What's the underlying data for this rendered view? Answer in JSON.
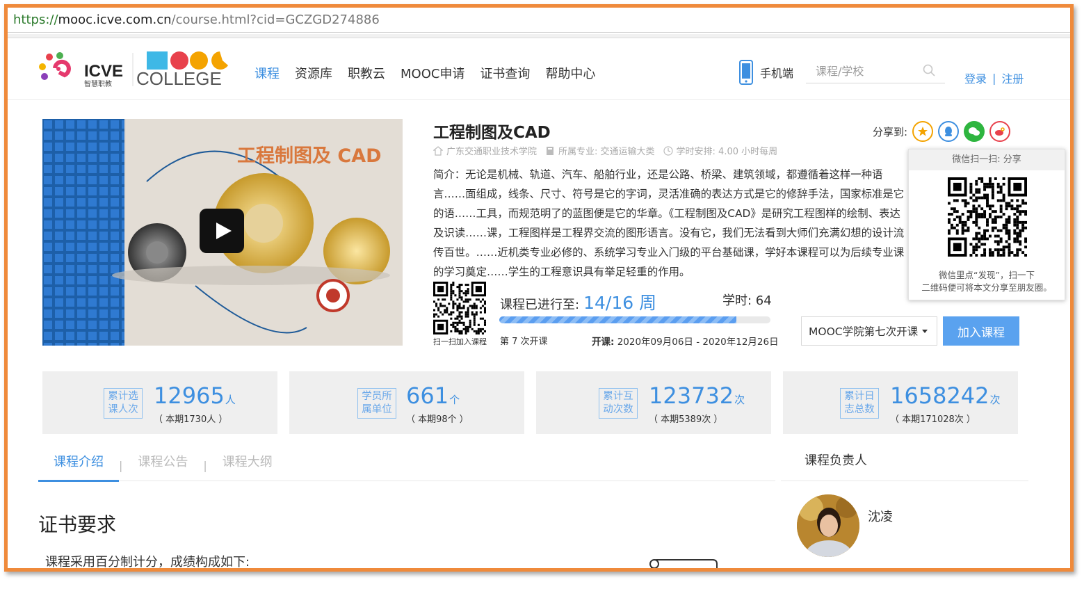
{
  "browser": {
    "url_scheme": "https://",
    "url_host": "mooc.icve.com.cn",
    "url_path": "/course.html?cid=GCZGD274886"
  },
  "header": {
    "logo_icve": "ICVE",
    "logo_icve_sub": "智慧职教",
    "logo_mooc": "MOOC",
    "logo_college": "COLLEGE",
    "nav": [
      "课程",
      "资源库",
      "职教云",
      "MOOC申请",
      "证书查询",
      "帮助中心"
    ],
    "mobile_label": "手机端",
    "search_placeholder": "课程/学校",
    "login": "登录",
    "divider": "|",
    "register": "注册"
  },
  "course": {
    "title": "工程制图及CAD",
    "video_title": "工程制图及 CAD",
    "school": "广东交通职业技术学院",
    "major": "所属专业: 交通运输大类",
    "hours_plan": "学时安排: 4.00 小时每周",
    "intro": "简介：无论是机械、轨道、汽车、船舶行业，还是公路、桥梁、建筑领域，都遵循着这样一种语言……面组成，线条、尺寸、符号是它的字词，灵活准确的表达方式是它的修辞手法，国家标准是它的语……工具，而规范明了的蓝图便是它的华章。《工程制图及CAD》是研究工程图样的绘制、表达及识读……课，工程图样是工程界交流的图形语言。没有它，我们无法看到大师们充满幻想的设计流传百世。……近机类专业必修的、系统学习专业入门级的平台基础课，学好本课程可以为后续专业课的学习奠定……学生的工程意识具有举足轻重的作用。",
    "qr_small_label": "扫一扫加入课程",
    "progress_label": "课程已进行至:",
    "progress_weeks": "14/16 周",
    "progress_fraction": 0.875,
    "hours": "学时: 64",
    "session": "第 7 次开课",
    "dates_label": "开课:",
    "dates": "2020年09月06日 - 2020年12月26日",
    "session_select": "MOOC学院第七次开课",
    "join_button": "加入课程"
  },
  "share": {
    "label": "分享到:",
    "popup_head": "微信扫一扫: 分享",
    "popup_foot_1": "微信里点“发现”，扫一下",
    "popup_foot_2": "二维码便可将本文分享至朋友圈。"
  },
  "stats": [
    {
      "tag1": "累计选",
      "tag2": "课人次",
      "num": "12965",
      "unit": "人",
      "sub": "（ 本期1730人 ）"
    },
    {
      "tag1": "学员所",
      "tag2": "属单位",
      "num": "661",
      "unit": "个",
      "sub": "（ 本期98个 ）"
    },
    {
      "tag1": "累计互",
      "tag2": "动次数",
      "num": "123732",
      "unit": "次",
      "sub": "（ 本期5389次 ）"
    },
    {
      "tag1": "累计日",
      "tag2": "志总数",
      "num": "1658242",
      "unit": "次",
      "sub": "（ 本期171028次 ）"
    }
  ],
  "tabs": [
    "课程介绍",
    "课程公告",
    "课程大纲"
  ],
  "tab_separator": "|",
  "leader": {
    "title": "课程负责人",
    "name": "沈凌"
  },
  "certificate": {
    "title": "证书要求",
    "text": "课程采用百分制计分，成绩构成如下:"
  },
  "colors": {
    "accent": "#3d8fe0",
    "frame": "#ef8a3b",
    "join_button": "#5aa2ef"
  }
}
